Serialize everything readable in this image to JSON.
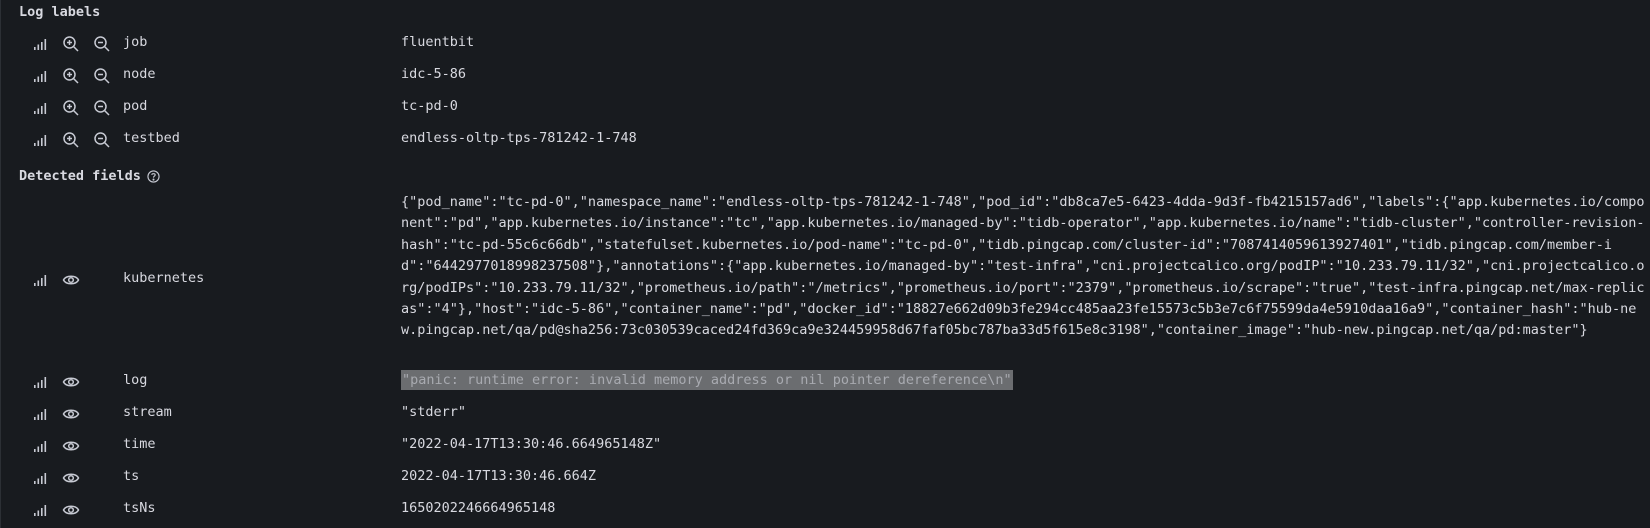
{
  "log_labels": {
    "title": "Log labels",
    "rows": [
      {
        "key": "job",
        "value": "fluentbit"
      },
      {
        "key": "node",
        "value": "idc-5-86"
      },
      {
        "key": "pod",
        "value": "tc-pd-0"
      },
      {
        "key": "testbed",
        "value": "endless-oltp-tps-781242-1-748"
      }
    ]
  },
  "detected_fields": {
    "title": "Detected fields",
    "help_icon": "question-circle-icon",
    "rows": [
      {
        "key": "kubernetes",
        "value": "{\"pod_name\":\"tc-pd-0\",\"namespace_name\":\"endless-oltp-tps-781242-1-748\",\"pod_id\":\"db8ca7e5-6423-4dda-9d3f-fb4215157ad6\",\"labels\":{\"app.kubernetes.io/component\":\"pd\",\"app.kubernetes.io/instance\":\"tc\",\"app.kubernetes.io/managed-by\":\"tidb-operator\",\"app.kubernetes.io/name\":\"tidb-cluster\",\"controller-revision-hash\":\"tc-pd-55c6c66db\",\"statefulset.kubernetes.io/pod-name\":\"tc-pd-0\",\"tidb.pingcap.com/cluster-id\":\"7087414059613927401\",\"tidb.pingcap.com/member-id\":\"6442977018998237508\"},\"annotations\":{\"app.kubernetes.io/managed-by\":\"test-infra\",\"cni.projectcalico.org/podIP\":\"10.233.79.11/32\",\"cni.projectcalico.org/podIPs\":\"10.233.79.11/32\",\"prometheus.io/path\":\"/metrics\",\"prometheus.io/port\":\"2379\",\"prometheus.io/scrape\":\"true\",\"test-infra.pingcap.net/max-replicas\":\"4\"},\"host\":\"idc-5-86\",\"container_name\":\"pd\",\"docker_id\":\"18827e662d09b3fe294cc485aa23fe15573c5b3e7c6f75599da4e5910daa16a9\",\"container_hash\":\"hub-new.pingcap.net/qa/pd@sha256:73c030539caced24fd369ca9e324459958d67faf05bc787ba33d5f615e8c3198\",\"container_image\":\"hub-new.pingcap.net/qa/pd:master\"}"
      },
      {
        "key": "log",
        "value": "\"panic: runtime error: invalid memory address or nil pointer dereference\\n\""
      },
      {
        "key": "stream",
        "value": "\"stderr\""
      },
      {
        "key": "time",
        "value": "\"2022-04-17T13:30:46.664965148Z\""
      },
      {
        "key": "ts",
        "value": "2022-04-17T13:30:46.664Z"
      },
      {
        "key": "tsNs",
        "value": "1650202246664965148"
      }
    ]
  },
  "icons": {
    "stats": "signal-bars-icon",
    "filter_for": "zoom-in-icon",
    "filter_out": "zoom-out-icon",
    "toggle_field": "eye-icon"
  }
}
